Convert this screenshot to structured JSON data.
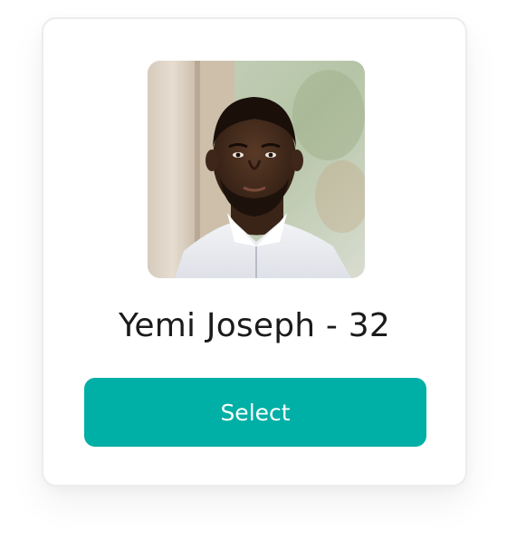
{
  "profile": {
    "name_line": "Yemi Joseph - 32",
    "photo_description_icon": "profile-photo"
  },
  "actions": {
    "select_label": "Select"
  },
  "colors": {
    "accent": "#00afa5",
    "text": "#1b1b1b",
    "card_border": "#ececec"
  }
}
